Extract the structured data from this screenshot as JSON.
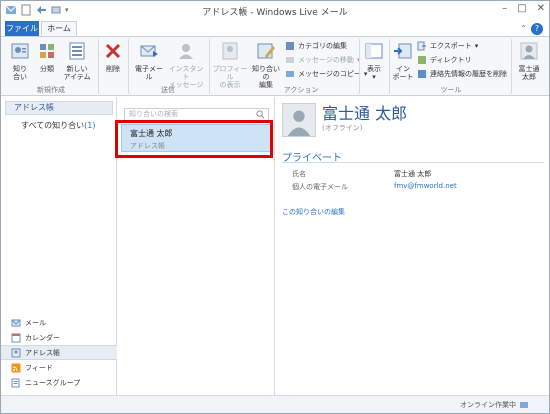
{
  "window": {
    "title": "アドレス帳 - Windows Live メール"
  },
  "tabs": {
    "file": "ファイル",
    "home": "ホーム"
  },
  "ribbon": {
    "new_group": {
      "label": "新規作成",
      "contact": "知り\n合い",
      "category": "分類",
      "new_item": "新しい\nアイテム"
    },
    "delete": "削除",
    "send_group": {
      "label": "送信",
      "email": "電子メール",
      "im": "インスタント\nメッセージ"
    },
    "action_group": {
      "label": "アクション",
      "profile": "プロフィール\nの表示",
      "edit": "知り合いの\n編集",
      "cat_edit": "カテゴリの編集",
      "msg_move": "メッセージの移動",
      "msg_copy": "メッセージのコピー"
    },
    "view": "表示",
    "tools_group": {
      "label": "ツール",
      "import": "イン\nポート",
      "export": "エクスポート",
      "directory": "ディレクトリ",
      "delete_history": "連絡先情報の履歴を削除"
    },
    "user": "富士通\n太郎"
  },
  "nav": {
    "header": "アドレス帳",
    "all_contacts": "すべての知り合い",
    "all_count": "(1)",
    "items": [
      {
        "label": "メール",
        "icon": "mail-icon"
      },
      {
        "label": "カレンダー",
        "icon": "calendar-icon"
      },
      {
        "label": "アドレス帳",
        "icon": "contacts-icon"
      },
      {
        "label": "フィード",
        "icon": "feed-icon"
      },
      {
        "label": "ニュースグループ",
        "icon": "newsgroup-icon"
      }
    ]
  },
  "list": {
    "search_placeholder": "知り合いの検索",
    "contact": {
      "name": "富士通 太郎",
      "sub": "アドレス帳"
    }
  },
  "detail": {
    "name": "富士通 太郎",
    "status": "(オフライン)",
    "section": "プライベート",
    "fields": [
      {
        "label": "氏名",
        "value": "富士通 太郎"
      },
      {
        "label": "個人の電子メール",
        "value": "fmv@fmworld.net"
      }
    ],
    "edit_link": "この知り合いの編集"
  },
  "status": {
    "text": "オンライン作業中"
  },
  "colors": {
    "accent": "#2a71c6",
    "highlight": "#e00000",
    "selection": "#cfe3f7"
  }
}
